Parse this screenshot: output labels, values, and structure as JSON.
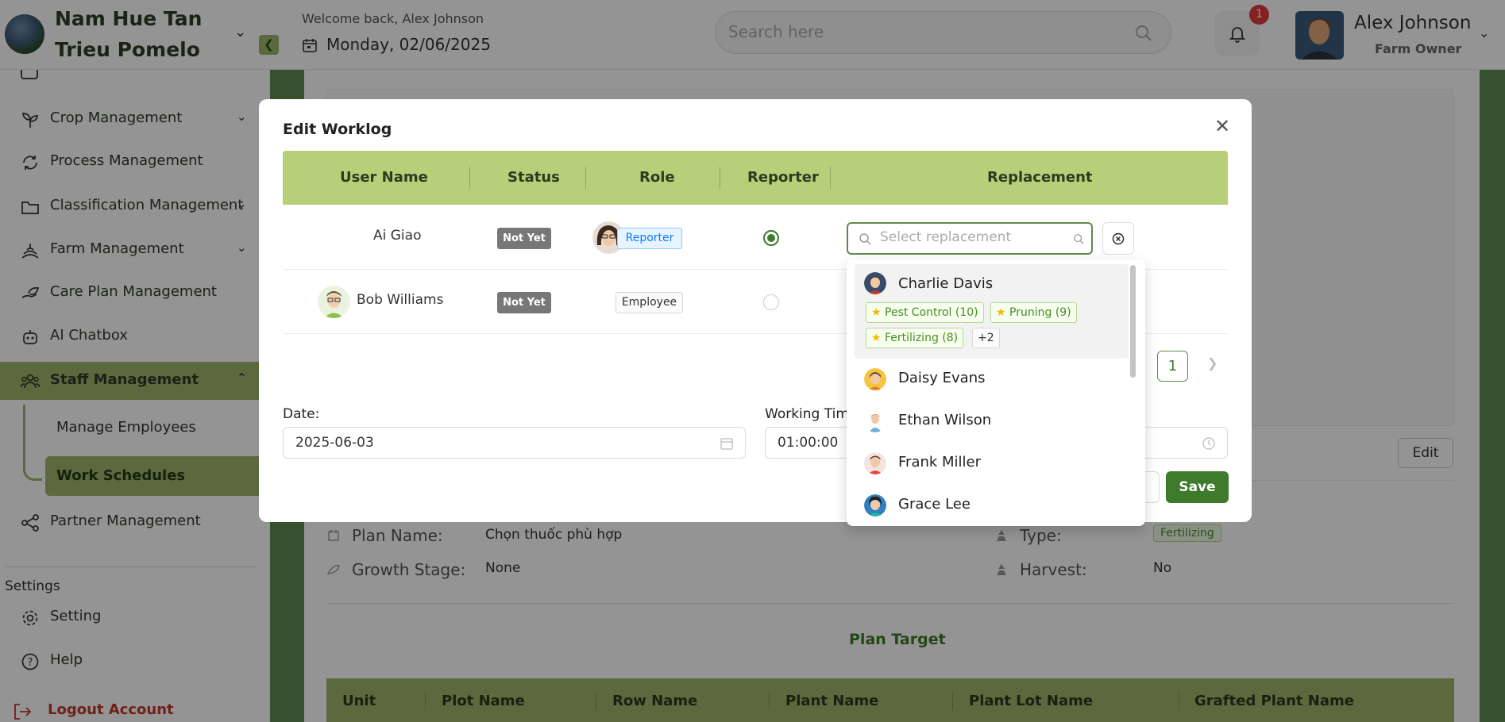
{
  "header": {
    "farm_name": "Nam Hue Tan Trieu Pomelo",
    "welcome": "Welcome back, Alex Johnson",
    "date": "Monday, 02/06/2025",
    "search_placeholder": "Search here",
    "notification_count": "1",
    "user_name": "Alex Johnson",
    "user_role": "Farm Owner"
  },
  "sidebar": {
    "items": [
      {
        "label": "Crop Management",
        "icon": "sprout-icon"
      },
      {
        "label": "Process Management",
        "icon": "cycle-icon"
      },
      {
        "label": "Classification Management",
        "icon": "folder-icon"
      },
      {
        "label": "Farm Management",
        "icon": "farm-icon"
      },
      {
        "label": "Care Plan Management",
        "icon": "leaf-hand-icon"
      },
      {
        "label": "AI Chatbox",
        "icon": "robot-icon"
      },
      {
        "label": "Staff Management",
        "icon": "users-icon"
      },
      {
        "label": "Partner Management",
        "icon": "share-icon"
      }
    ],
    "sub_items": [
      "Manage Employees",
      "Work Schedules"
    ],
    "settings_heading": "Settings",
    "setting": "Setting",
    "help": "Help",
    "logout": "Logout Account"
  },
  "detail": {
    "edit_label": "Edit",
    "plan_name_label": "Plan Name:",
    "plan_name": "Chọn thuốc phù hợp",
    "growth_stage_label": "Growth Stage:",
    "growth_stage": "None",
    "type_label": "Type:",
    "type": "Fertilizing",
    "harvest_label": "Harvest:",
    "harvest": "No",
    "plan_target_title": "Plan Target",
    "plan_target_columns": [
      "Unit",
      "Plot Name",
      "Row Name",
      "Plant Name",
      "Plant Lot Name",
      "Grafted Plant Name"
    ]
  },
  "modal": {
    "title": "Edit Worklog",
    "columns": [
      "User Name",
      "Status",
      "Role",
      "Reporter",
      "Replacement"
    ],
    "rows": [
      {
        "name": "Ai Giao",
        "status": "Not Yet",
        "role": "Reporter",
        "reporter": true
      },
      {
        "name": "Bob Williams",
        "status": "Not Yet",
        "role": "Employee",
        "reporter": false
      }
    ],
    "replacement_placeholder": "Select replacement",
    "page": "1",
    "date_label": "Date:",
    "date_value": "2025-06-03",
    "working_time_label": "Working Time",
    "working_time_value": "01:00:00",
    "save_label": "Save"
  },
  "dropdown": {
    "options": [
      {
        "name": "Charlie Davis",
        "skills": [
          "Pest Control (10)",
          "Pruning (9)",
          "Fertilizing (8)"
        ],
        "more": "+2"
      },
      {
        "name": "Daisy Evans"
      },
      {
        "name": "Ethan Wilson"
      },
      {
        "name": "Frank Miller"
      },
      {
        "name": "Grace Lee"
      }
    ]
  },
  "colors": {
    "brand_green": "#9cb56b",
    "dark_green": "#3d7a2b",
    "badge_red": "#e23b3b"
  }
}
